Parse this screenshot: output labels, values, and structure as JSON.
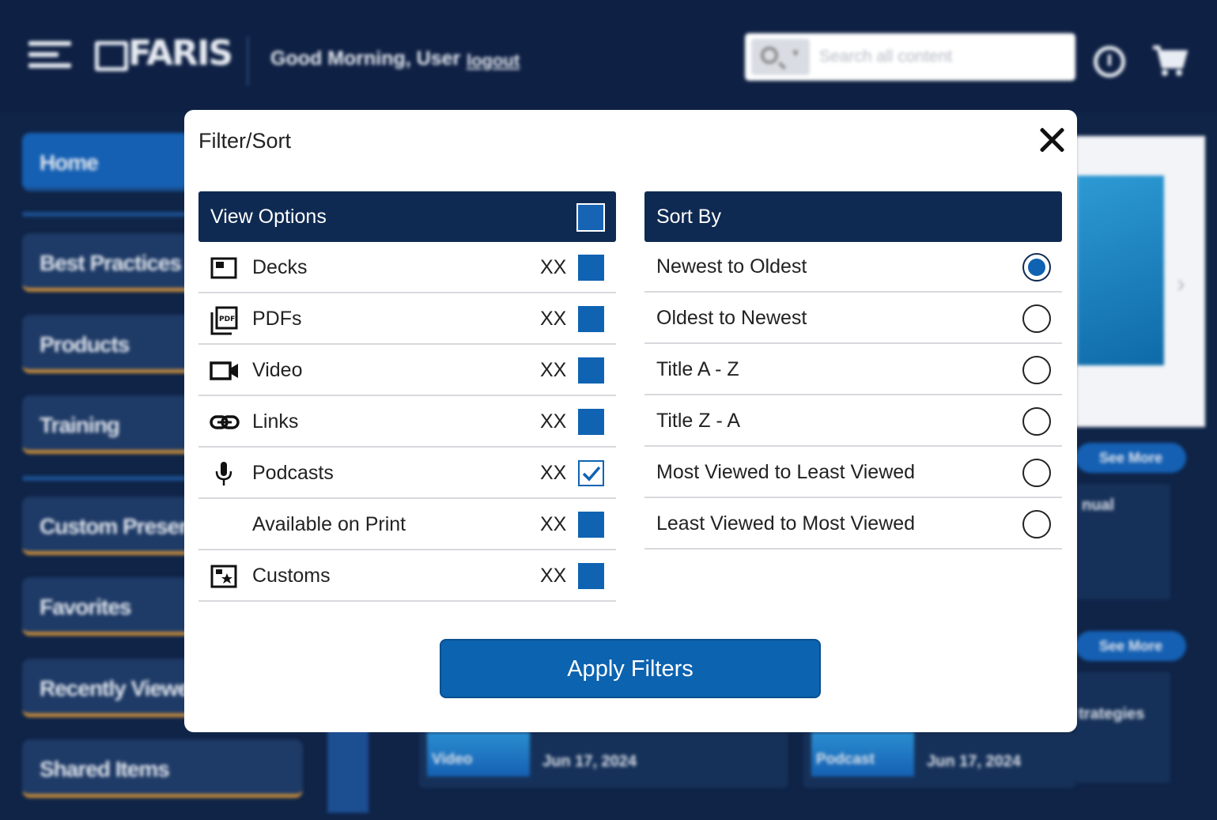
{
  "app": {
    "logo_text": "FARIS",
    "greeting": "Good Morning, User",
    "logout_label": "logout",
    "search": {
      "placeholder": "Search all content"
    }
  },
  "sidebar": {
    "items": [
      {
        "label": "Home",
        "active": true
      },
      {
        "label": "Best Practices"
      },
      {
        "label": "Products"
      },
      {
        "label": "Training"
      },
      {
        "label": "Custom Presentations"
      },
      {
        "label": "Favorites"
      },
      {
        "label": "Recently Viewed"
      },
      {
        "label": "Shared Items"
      }
    ]
  },
  "content": {
    "see_more_1": "See More",
    "see_more_2": "See More",
    "card_partial_1": "nual",
    "card_partial_2": "trategies",
    "cards": [
      {
        "type": "Video",
        "date": "Jun 17, 2024"
      },
      {
        "type": "Podcast",
        "date": "Jun 17, 2024"
      }
    ]
  },
  "modal": {
    "title": "Filter/Sort",
    "view_options": {
      "heading": "View Options",
      "items": [
        {
          "label": "Decks",
          "count": "XX",
          "checked": false,
          "icon": "deck-icon"
        },
        {
          "label": "PDFs",
          "count": "XX",
          "checked": false,
          "icon": "pdf-icon"
        },
        {
          "label": "Video",
          "count": "XX",
          "checked": false,
          "icon": "video-icon"
        },
        {
          "label": "Links",
          "count": "XX",
          "checked": false,
          "icon": "link-icon"
        },
        {
          "label": "Podcasts",
          "count": "XX",
          "checked": true,
          "icon": "microphone-icon"
        },
        {
          "label": "Available on Print",
          "count": "XX",
          "checked": false,
          "icon": ""
        },
        {
          "label": "Customs",
          "count": "XX",
          "checked": false,
          "icon": "custom-star-icon"
        }
      ]
    },
    "sort_by": {
      "heading": "Sort By",
      "options": [
        {
          "label": "Newest to Oldest",
          "selected": true
        },
        {
          "label": "Oldest to Newest",
          "selected": false
        },
        {
          "label": "Title A - Z",
          "selected": false
        },
        {
          "label": "Title Z - A",
          "selected": false
        },
        {
          "label": "Most Viewed to Least Viewed",
          "selected": false
        },
        {
          "label": "Least Viewed to Most Viewed",
          "selected": false
        }
      ]
    },
    "apply_label": "Apply Filters"
  },
  "colors": {
    "navy": "#0f2a52",
    "accent_blue": "#0c63b0",
    "background": "#0f2447",
    "sidebar_border": "#c48a3b"
  }
}
